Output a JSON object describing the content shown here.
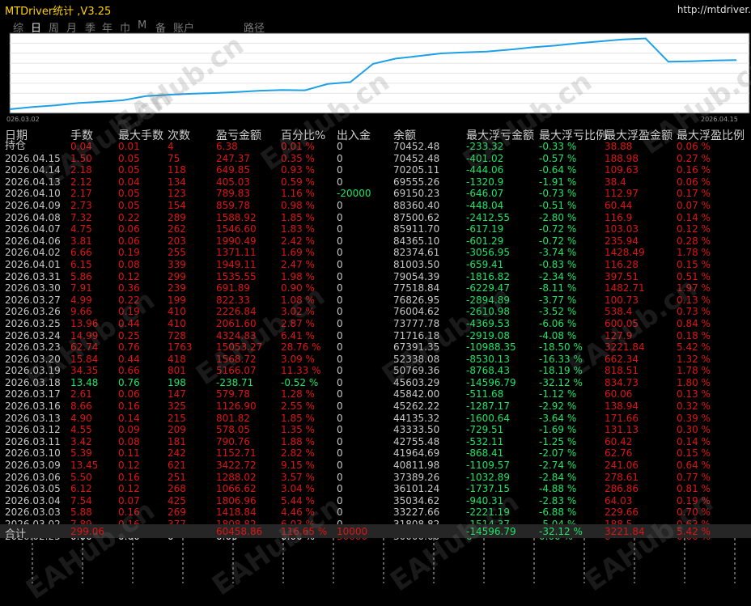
{
  "app": {
    "title": "MTDriver统计 ,V3.25",
    "url": "http://mtdriver."
  },
  "tabs": [
    {
      "label": "综",
      "active": false
    },
    {
      "label": "日",
      "active": true
    },
    {
      "label": "周",
      "active": false
    },
    {
      "label": "月",
      "active": false
    },
    {
      "label": "季",
      "active": false
    },
    {
      "label": "年",
      "active": false
    },
    {
      "label": "巾",
      "active": false
    },
    {
      "label": "M",
      "active": false
    },
    {
      "label": "备",
      "active": false
    },
    {
      "label": "账户",
      "active": false
    },
    {
      "label": "路径",
      "active": false
    }
  ],
  "chart_data": {
    "type": "line",
    "x_start_label": "026.03.02",
    "x_end_label": "2026.04.15",
    "line_color": "#1ea0e6",
    "grid": true,
    "series": [
      {
        "values": [
          30000,
          31808.82,
          33227.66,
          35034.62,
          36101.24,
          37389.26,
          40811.98,
          41964.69,
          42755.48,
          43333.5,
          44135.32,
          45262.22,
          45842.0,
          45603.29,
          50769.36,
          52338.08,
          67391.35,
          71716.18,
          73777.78,
          76004.62,
          76826.95,
          77518.84,
          79054.39,
          81003.5,
          82374.61,
          84365.1,
          85911.7,
          87500.62,
          88360.4,
          69150.23,
          69555.26,
          70205.11,
          70452.48
        ]
      }
    ]
  },
  "headers": {
    "date": "日期",
    "lots": "手数",
    "maxlots": "最大手数",
    "count": "次数",
    "pnl": "盈亏金额",
    "pct": "百分比%",
    "deposit": "出入金",
    "balance": "余额",
    "maxfloat": "最大浮亏金额",
    "maxfloatpct": "最大浮亏比例",
    "maxprofit": "最大浮盈金额",
    "maxprofitpct": "最大浮盈比例"
  },
  "rows": [
    {
      "date": "持仓",
      "lots": "0.04",
      "maxlots": "0.01",
      "count": "4",
      "pnl": "6.38",
      "pct": "0.01 %",
      "deposit": "0",
      "balance": "70452.48",
      "mf": "-233.32",
      "mfp": "-0.33 %",
      "mp": "38.88",
      "mpp": "0.06 %",
      "color": "red"
    },
    {
      "date": "2026.04.15",
      "lots": "1.50",
      "maxlots": "0.05",
      "count": "75",
      "pnl": "247.37",
      "pct": "0.35 %",
      "deposit": "0",
      "balance": "70452.48",
      "mf": "-401.02",
      "mfp": "-0.57 %",
      "mp": "188.98",
      "mpp": "0.27 %",
      "color": "red"
    },
    {
      "date": "2026.04.14",
      "lots": "2.18",
      "maxlots": "0.05",
      "count": "118",
      "pnl": "649.85",
      "pct": "0.93 %",
      "deposit": "0",
      "balance": "70205.11",
      "mf": "-444.06",
      "mfp": "-0.64 %",
      "mp": "109.63",
      "mpp": "0.16 %",
      "color": "red"
    },
    {
      "date": "2026.04.13",
      "lots": "2.12",
      "maxlots": "0.04",
      "count": "134",
      "pnl": "405.03",
      "pct": "0.59 %",
      "deposit": "0",
      "balance": "69555.26",
      "mf": "-1320.9",
      "mfp": "-1.91 %",
      "mp": "38.4",
      "mpp": "0.06 %",
      "color": "red"
    },
    {
      "date": "2026.04.10",
      "lots": "2.17",
      "maxlots": "0.05",
      "count": "123",
      "pnl": "789.83",
      "pct": "1.16 %",
      "deposit": "-20000",
      "balance": "69150.23",
      "mf": "-646.07",
      "mfp": "-0.73 %",
      "mp": "112.97",
      "mpp": "0.17 %",
      "color": "red"
    },
    {
      "date": "2026.04.09",
      "lots": "2.73",
      "maxlots": "0.05",
      "count": "154",
      "pnl": "859.78",
      "pct": "0.98 %",
      "deposit": "0",
      "balance": "88360.40",
      "mf": "-448.04",
      "mfp": "-0.51 %",
      "mp": "60.44",
      "mpp": "0.07 %",
      "color": "red"
    },
    {
      "date": "2026.04.08",
      "lots": "7.32",
      "maxlots": "0.22",
      "count": "289",
      "pnl": "1588.92",
      "pct": "1.85 %",
      "deposit": "0",
      "balance": "87500.62",
      "mf": "-2412.55",
      "mfp": "-2.80 %",
      "mp": "116.9",
      "mpp": "0.14 %",
      "color": "red"
    },
    {
      "date": "2026.04.07",
      "lots": "4.75",
      "maxlots": "0.06",
      "count": "262",
      "pnl": "1546.60",
      "pct": "1.83 %",
      "deposit": "0",
      "balance": "85911.70",
      "mf": "-617.19",
      "mfp": "-0.72 %",
      "mp": "103.03",
      "mpp": "0.12 %",
      "color": "red"
    },
    {
      "date": "2026.04.06",
      "lots": "3.81",
      "maxlots": "0.06",
      "count": "203",
      "pnl": "1990.49",
      "pct": "2.42 %",
      "deposit": "0",
      "balance": "84365.10",
      "mf": "-601.29",
      "mfp": "-0.72 %",
      "mp": "235.94",
      "mpp": "0.28 %",
      "color": "red"
    },
    {
      "date": "2026.04.02",
      "lots": "6.66",
      "maxlots": "0.19",
      "count": "255",
      "pnl": "1371.11",
      "pct": "1.69 %",
      "deposit": "0",
      "balance": "82374.61",
      "mf": "-3056.95",
      "mfp": "-3.74 %",
      "mp": "1428.49",
      "mpp": "1.78 %",
      "color": "red"
    },
    {
      "date": "2026.04.01",
      "lots": "6.15",
      "maxlots": "0.08",
      "count": "339",
      "pnl": "1949.11",
      "pct": "2.47 %",
      "deposit": "0",
      "balance": "81003.50",
      "mf": "-659.41",
      "mfp": "-0.83 %",
      "mp": "116.28",
      "mpp": "0.15 %",
      "color": "red"
    },
    {
      "date": "2026.03.31",
      "lots": "5.86",
      "maxlots": "0.12",
      "count": "299",
      "pnl": "1535.55",
      "pct": "1.98 %",
      "deposit": "0",
      "balance": "79054.39",
      "mf": "-1816.82",
      "mfp": "-2.34 %",
      "mp": "397.51",
      "mpp": "0.51 %",
      "color": "red"
    },
    {
      "date": "2026.03.30",
      "lots": "7.91",
      "maxlots": "0.36",
      "count": "239",
      "pnl": "691.89",
      "pct": "0.90 %",
      "deposit": "0",
      "balance": "77518.84",
      "mf": "-6229.47",
      "mfp": "-8.11 %",
      "mp": "1482.71",
      "mpp": "1.97 %",
      "color": "red"
    },
    {
      "date": "2026.03.27",
      "lots": "4.99",
      "maxlots": "0.22",
      "count": "199",
      "pnl": "822.33",
      "pct": "1.08 %",
      "deposit": "0",
      "balance": "76826.95",
      "mf": "-2894.89",
      "mfp": "-3.77 %",
      "mp": "100.73",
      "mpp": "0.13 %",
      "color": "red"
    },
    {
      "date": "2026.03.26",
      "lots": "9.66",
      "maxlots": "0.19",
      "count": "410",
      "pnl": "2226.84",
      "pct": "3.02 %",
      "deposit": "0",
      "balance": "76004.62",
      "mf": "-2610.98",
      "mfp": "-3.52 %",
      "mp": "538.4",
      "mpp": "0.73 %",
      "color": "red"
    },
    {
      "date": "2026.03.25",
      "lots": "13.96",
      "maxlots": "0.44",
      "count": "410",
      "pnl": "2061.60",
      "pct": "2.87 %",
      "deposit": "0",
      "balance": "73777.78",
      "mf": "-4369.53",
      "mfp": "-6.06 %",
      "mp": "600.05",
      "mpp": "0.84 %",
      "color": "red"
    },
    {
      "date": "2026.03.24",
      "lots": "14.99",
      "maxlots": "0.25",
      "count": "728",
      "pnl": "4324.83",
      "pct": "6.41 %",
      "deposit": "0",
      "balance": "71716.18",
      "mf": "-2919.08",
      "mfp": "-4.08 %",
      "mp": "127.9",
      "mpp": "0.18 %",
      "color": "red"
    },
    {
      "date": "2026.03.23",
      "lots": "62.74",
      "maxlots": "0.76",
      "count": "1763",
      "pnl": "15053.27",
      "pct": "28.76 %",
      "deposit": "0",
      "balance": "67391.35",
      "mf": "-10988.35",
      "mfp": "-18.50 %",
      "mp": "3221.84",
      "mpp": "5.42 %",
      "color": "red"
    },
    {
      "date": "2026.03.20",
      "lots": "15.84",
      "maxlots": "0.44",
      "count": "418",
      "pnl": "1568.72",
      "pct": "3.09 %",
      "deposit": "0",
      "balance": "52338.08",
      "mf": "-8530.13",
      "mfp": "-16.33 %",
      "mp": "662.34",
      "mpp": "1.32 %",
      "color": "red"
    },
    {
      "date": "2026.03.19",
      "lots": "34.35",
      "maxlots": "0.66",
      "count": "801",
      "pnl": "5166.07",
      "pct": "11.33 %",
      "deposit": "0",
      "balance": "50769.36",
      "mf": "-8768.43",
      "mfp": "-18.19 %",
      "mp": "818.51",
      "mpp": "1.78 %",
      "color": "red"
    },
    {
      "date": "2026.03.18",
      "lots": "13.48",
      "maxlots": "0.76",
      "count": "198",
      "pnl": "-238.71",
      "pct": "-0.52 %",
      "deposit": "0",
      "balance": "45603.29",
      "mf": "-14596.79",
      "mfp": "-32.12 %",
      "mp": "834.73",
      "mpp": "1.80 %",
      "color": "green"
    },
    {
      "date": "2026.03.17",
      "lots": "2.61",
      "maxlots": "0.06",
      "count": "147",
      "pnl": "579.78",
      "pct": "1.28 %",
      "deposit": "0",
      "balance": "45842.00",
      "mf": "-511.68",
      "mfp": "-1.12 %",
      "mp": "60.06",
      "mpp": "0.13 %",
      "color": "red"
    },
    {
      "date": "2026.03.16",
      "lots": "8.66",
      "maxlots": "0.16",
      "count": "325",
      "pnl": "1126.90",
      "pct": "2.55 %",
      "deposit": "0",
      "balance": "45262.22",
      "mf": "-1287.17",
      "mfp": "-2.92 %",
      "mp": "138.94",
      "mpp": "0.32 %",
      "color": "red"
    },
    {
      "date": "2026.03.13",
      "lots": "4.90",
      "maxlots": "0.14",
      "count": "215",
      "pnl": "801.82",
      "pct": "1.85 %",
      "deposit": "0",
      "balance": "44135.32",
      "mf": "-1600.64",
      "mfp": "-3.64 %",
      "mp": "171.66",
      "mpp": "0.39 %",
      "color": "red"
    },
    {
      "date": "2026.03.12",
      "lots": "4.55",
      "maxlots": "0.09",
      "count": "209",
      "pnl": "578.05",
      "pct": "1.35 %",
      "deposit": "0",
      "balance": "43333.50",
      "mf": "-729.51",
      "mfp": "-1.69 %",
      "mp": "131.13",
      "mpp": "0.30 %",
      "color": "red"
    },
    {
      "date": "2026.03.11",
      "lots": "3.42",
      "maxlots": "0.08",
      "count": "181",
      "pnl": "790.76",
      "pct": "1.88 %",
      "deposit": "0",
      "balance": "42755.48",
      "mf": "-532.11",
      "mfp": "-1.25 %",
      "mp": "60.42",
      "mpp": "0.14 %",
      "color": "red"
    },
    {
      "date": "2026.03.10",
      "lots": "5.39",
      "maxlots": "0.11",
      "count": "242",
      "pnl": "1152.71",
      "pct": "2.82 %",
      "deposit": "0",
      "balance": "41964.69",
      "mf": "-868.41",
      "mfp": "-2.07 %",
      "mp": "62.76",
      "mpp": "0.15 %",
      "color": "red"
    },
    {
      "date": "2026.03.09",
      "lots": "13.45",
      "maxlots": "0.12",
      "count": "621",
      "pnl": "3422.72",
      "pct": "9.15 %",
      "deposit": "0",
      "balance": "40811.98",
      "mf": "-1109.57",
      "mfp": "-2.74 %",
      "mp": "241.06",
      "mpp": "0.64 %",
      "color": "red"
    },
    {
      "date": "2026.03.06",
      "lots": "5.50",
      "maxlots": "0.16",
      "count": "251",
      "pnl": "1288.02",
      "pct": "3.57 %",
      "deposit": "0",
      "balance": "37389.26",
      "mf": "-1032.89",
      "mfp": "-2.84 %",
      "mp": "278.61",
      "mpp": "0.77 %",
      "color": "red"
    },
    {
      "date": "2026.03.05",
      "lots": "6.12",
      "maxlots": "0.12",
      "count": "268",
      "pnl": "1066.62",
      "pct": "3.04 %",
      "deposit": "0",
      "balance": "36101.24",
      "mf": "-1737.15",
      "mfp": "-4.88 %",
      "mp": "286.86",
      "mpp": "0.81 %",
      "color": "red"
    },
    {
      "date": "2026.03.04",
      "lots": "7.54",
      "maxlots": "0.07",
      "count": "425",
      "pnl": "1806.96",
      "pct": "5.44 %",
      "deposit": "0",
      "balance": "35034.62",
      "mf": "-940.31",
      "mfp": "-2.83 %",
      "mp": "64.03",
      "mpp": "0.19 %",
      "color": "red"
    },
    {
      "date": "2026.03.03",
      "lots": "5.88",
      "maxlots": "0.16",
      "count": "269",
      "pnl": "1418.84",
      "pct": "4.46 %",
      "deposit": "0",
      "balance": "33227.66",
      "mf": "-2221.19",
      "mfp": "-6.88 %",
      "mp": "229.66",
      "mpp": "0.70 %",
      "color": "red"
    },
    {
      "date": "2026.03.02",
      "lots": "7.89",
      "maxlots": "0.16",
      "count": "377",
      "pnl": "1808.82",
      "pct": "6.03 %",
      "deposit": "0",
      "balance": "31808.82",
      "mf": "-1514.37",
      "mfp": "-5.04 %",
      "mp": "188.5",
      "mpp": "0.63 %",
      "color": "red"
    },
    {
      "date": "2026.02.25",
      "lots": "0.00",
      "maxlots": "0.00",
      "count": "0",
      "pnl": "0.00",
      "pct": "0.00 %",
      "deposit": "30000",
      "balance": "30000.00",
      "mf": "0",
      "mfp": "0.00 %",
      "mp": "0",
      "mpp": "0.00 %",
      "color": "white"
    }
  ],
  "total": {
    "label": "合计",
    "lots": "299.06",
    "pnl": "60458.86",
    "pct": "116.65 %",
    "deposit": "10000",
    "mf": "-14596.79",
    "mfp": "-32.12 %",
    "mp": "3221.84",
    "mpp": "5.42 %"
  },
  "watermark": "EAHub.cn"
}
